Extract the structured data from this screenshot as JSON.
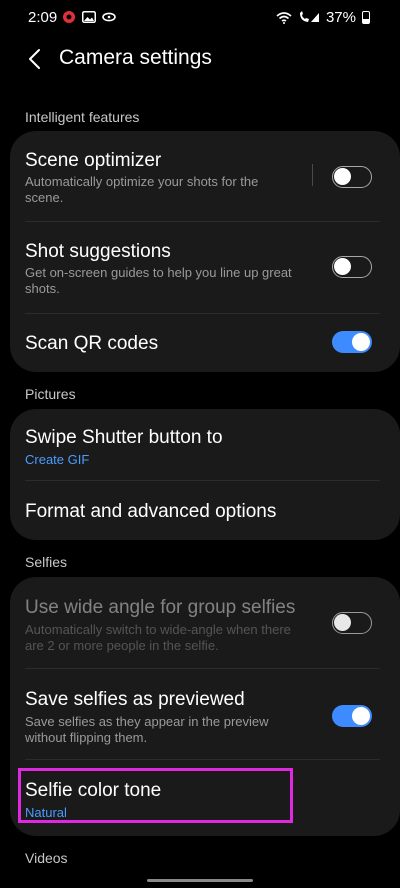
{
  "status": {
    "time": "2:09",
    "battery": "37%"
  },
  "header": {
    "title": "Camera settings"
  },
  "sections": {
    "intelligent": "Intelligent features",
    "pictures": "Pictures",
    "selfies": "Selfies",
    "videos": "Videos"
  },
  "intelligent": {
    "scene_optimizer": {
      "title": "Scene optimizer",
      "sub1": "Automatically optimize your shots for the",
      "sub2": "scene.",
      "enabled": false
    },
    "shot_suggestions": {
      "title": "Shot suggestions",
      "sub1": "Get on-screen guides to help you line up great",
      "sub2": "shots.",
      "enabled": false
    },
    "scan_qr": {
      "title": "Scan QR codes",
      "enabled": true
    }
  },
  "pictures": {
    "swipe_shutter": {
      "title": "Swipe Shutter button to",
      "value": "Create GIF"
    },
    "format_options": {
      "title": "Format and advanced options"
    }
  },
  "selfies": {
    "wide_angle": {
      "title": "Use wide angle for group selfies",
      "sub1": "Automatically switch to wide-angle when there",
      "sub2": "are 2 or more people in the selfie.",
      "enabled": false
    },
    "save_previewed": {
      "title": "Save selfies as previewed",
      "sub1": "Save selfies as they appear in the preview",
      "sub2": "without flipping them.",
      "enabled": true
    },
    "color_tone": {
      "title": "Selfie color tone",
      "value": "Natural"
    }
  },
  "colors": {
    "accent": "#3e8bff",
    "highlight": "#e028e0"
  }
}
